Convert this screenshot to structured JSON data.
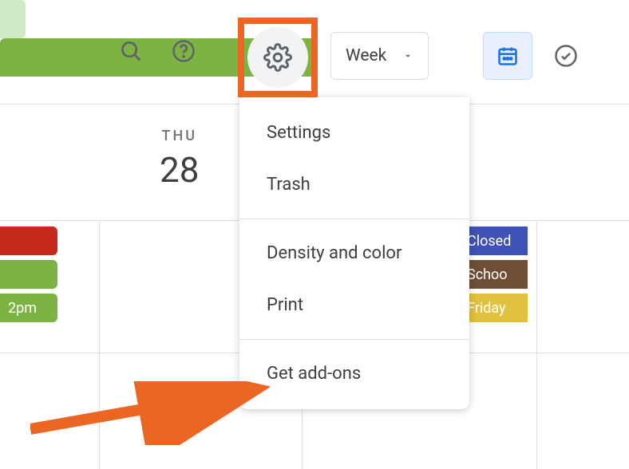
{
  "toolbar": {
    "view_label": "Week"
  },
  "day": {
    "label": "THU",
    "number": "28"
  },
  "events": {
    "e1_time": "2pm",
    "closed": "Closed",
    "school": "Schoo",
    "friday": "Friday"
  },
  "menu": {
    "settings": "Settings",
    "trash": "Trash",
    "density": "Density and color",
    "print": "Print",
    "addons": "Get add-ons"
  }
}
